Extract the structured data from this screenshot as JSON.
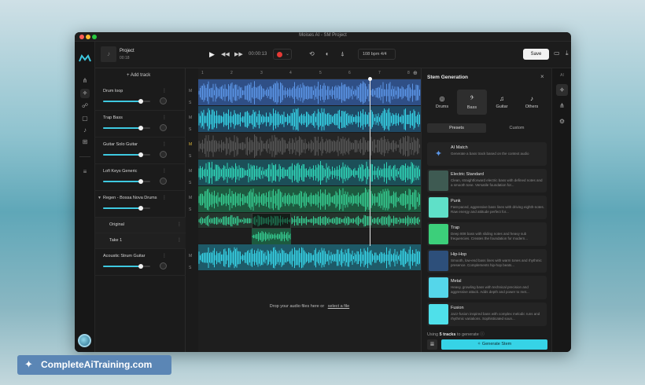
{
  "window": {
    "title": "Moises AI - SM Project"
  },
  "toolbar": {
    "project_name": "Project",
    "project_duration": "00:18",
    "time": "00:00:13",
    "tempo": "108 bpm 4/4",
    "save_label": "Save"
  },
  "tracks": {
    "add_label": "Add track",
    "drop_text": "Drop your audio files here or",
    "drop_link": "select a file",
    "items": [
      {
        "name": "Drum loop",
        "volume": 0.8
      },
      {
        "name": "Trap Bass",
        "volume": 0.8
      },
      {
        "name": "Guitar Solo Guitar",
        "volume": 0.8
      },
      {
        "name": "Lofi Keys Generic",
        "volume": 0.8
      },
      {
        "name": "Regen - Bossa Nova Drums",
        "volume": 0.8
      },
      {
        "name": "Original"
      },
      {
        "name": "Take 1"
      },
      {
        "name": "Acoustic Strum Guitar",
        "volume": 0.8
      }
    ]
  },
  "ruler": [
    "1",
    "2",
    "3",
    "4",
    "5",
    "6",
    "7",
    "8"
  ],
  "panel": {
    "title": "Stem Generation",
    "categories": [
      "Drums",
      "Bass",
      "Guitar",
      "Others"
    ],
    "tabs": [
      "Presets",
      "Custom"
    ],
    "presets": [
      {
        "name": "AI Match",
        "desc": "Generate a bass track based on the context audio"
      },
      {
        "name": "Electric Standard",
        "desc": "Clean, straightforward electric bass with defined notes and a smooth tone. Versatile foundation for..."
      },
      {
        "name": "Punk",
        "desc": "Fast-paced, aggressive bass lines with driving eighth-notes. Raw energy and attitude perfect for..."
      },
      {
        "name": "Trap",
        "desc": "Deep 808 bass with sliding notes and heavy sub frequencies. Creates the foundation for modern..."
      },
      {
        "name": "Hip-Hop",
        "desc": "Smooth, low-end bass lines with warm tones and rhythmic presence. Complements hip-hop beats..."
      },
      {
        "name": "Metal",
        "desc": "Heavy, growling bass with technical precision and aggressive attack. Adds depth and power to met..."
      },
      {
        "name": "Fusion",
        "desc": "Jazz-fusion inspired bass with complex melodic runs and rhythmic variations. Sophisticated soun..."
      }
    ],
    "using_prefix": "Using",
    "using_count": "5 tracks",
    "using_suffix": "to generate",
    "generate_label": "Generate Stem"
  },
  "rightrail": {
    "label": "AI"
  },
  "brand": {
    "text": "CompleteAiTraining.com"
  },
  "colors": {
    "accent": "#3ec9e0",
    "blue_wave": "#5b95e6",
    "cyan_wave": "#36d3e6",
    "teal_wave": "#2fd6b8",
    "green_wave": "#35c98f",
    "gray_wave": "#555555"
  }
}
